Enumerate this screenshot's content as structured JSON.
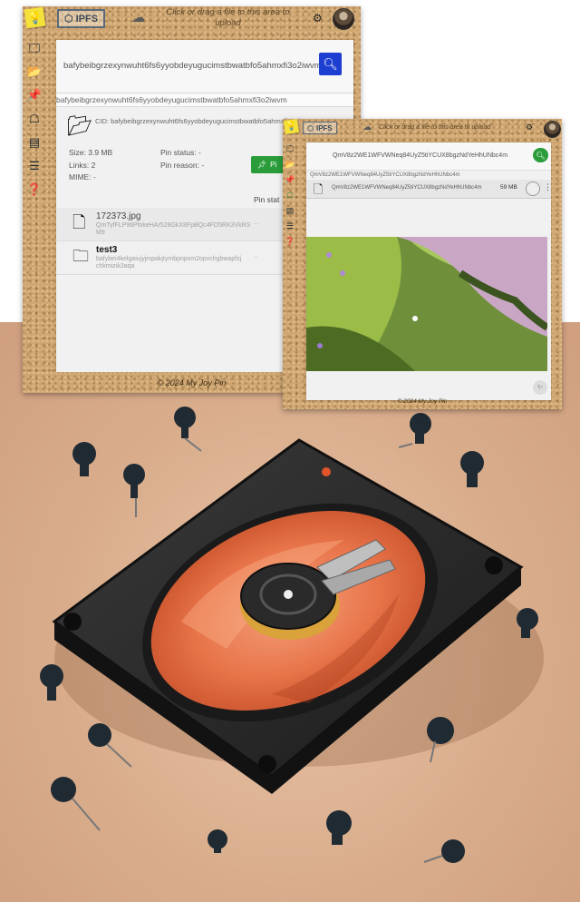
{
  "window_main": {
    "logo_text": "IPFS",
    "upload_prompt": "Click or drag a file to this area to upload",
    "footer": "© 2024 My Joy Pin",
    "search": {
      "value": "bafybeibgrzexynwuht6fs6yyobdeyugucimstbwatbfo5ahmxfi3o2iwvm",
      "button_icon": "search-icon"
    },
    "cid_bar": "bafybeibgrzexynwuht6fs6yyobdeyugucimstbwatbfo5ahmxfi3o2iwvm",
    "detail": {
      "cid_line": "CID: bafybeibgrzexynwuht6fs6yyobdeyugucimstbwatbfo5ahmxfi3o2iwvm",
      "size": "Size: 3.9 MB",
      "links": "Links: 2",
      "mime": "MIME: -",
      "pin_status": "Pin status: -",
      "pin_reason": "Pin reason: -",
      "pin_button": "Pi",
      "pin_status_header": "Pin stat"
    },
    "files": [
      {
        "name": "172373.jpg",
        "cid": "QmTyfFLP9tiPfokeHAr528GkX8FpBQc4FD5RK3VkRS M9",
        "size": "...",
        "icon": "file-icon"
      },
      {
        "name": "test3",
        "cid": "bafybei4kelgaiujyjmpakjtymbpnpxm2opvchgbwapfzj chkmizik3aqa",
        "size": "...",
        "icon": "folder-icon"
      }
    ],
    "nav_icons": [
      "monitor-icon",
      "folder-open-icon",
      "pin-icon",
      "network-icon",
      "card-icon",
      "checklist-icon",
      "help-icon"
    ]
  },
  "window_preview": {
    "logo_text": "IPFS",
    "upload_prompt": "Click or drag a file to this area to upload",
    "footer": "© 2024 My Joy Pin",
    "search_value": "QmV8z2WE1WFVWNeq84UyZ5tiYCUX8bgzNdYeHhUNbc4m",
    "cid_bar": "QmV8z2WE1WFVWNeq84UyZ5tiYCUX8bgzNdYeHhUNbc4m",
    "file": {
      "name": "QmV8z2WE1WFVWNeq84UyZ5tiYCUX8bgzNdYeHhUNbc4m",
      "size": "59 MB"
    }
  },
  "colors": {
    "search_blue": "#1c3fd1",
    "pin_green": "#2a9d3a",
    "cork": "#cfa672",
    "backdrop": "#d9ad8c",
    "drive_orange": "#e8744a"
  }
}
